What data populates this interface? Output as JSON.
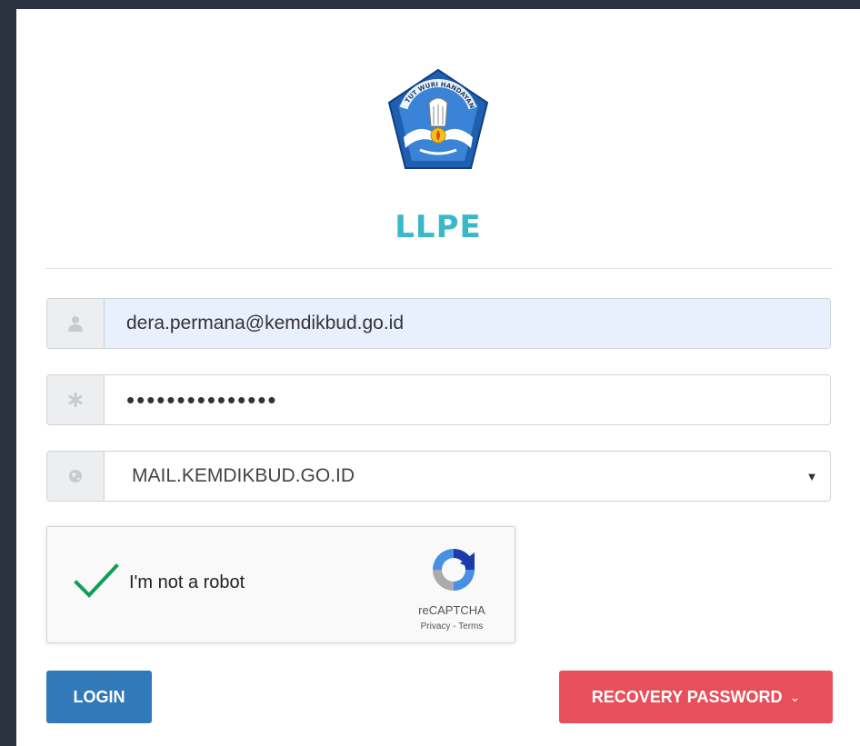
{
  "header": {
    "logo_alt": "Tut Wuri Handayani emblem",
    "logo_text": "TUT WURI HANDAYANI",
    "title": "LLPE"
  },
  "form": {
    "username": {
      "value": "dera.permana@kemdikbud.go.id",
      "icon": "user-icon"
    },
    "password": {
      "value": "•••••••••••••••",
      "icon": "asterisk-icon"
    },
    "server": {
      "selected": "MAIL.KEMDIKBUD.GO.ID",
      "icon": "globe-icon"
    }
  },
  "recaptcha": {
    "label": "I'm not a robot",
    "checked": true,
    "brand": "reCAPTCHA",
    "privacy": "Privacy",
    "separator": " - ",
    "terms": "Terms"
  },
  "buttons": {
    "login": "LOGIN",
    "recovery": "RECOVERY PASSWORD",
    "recovery_chevron": "⌄"
  },
  "colors": {
    "title": "#3bb8c8",
    "login_button": "#3179b8",
    "recovery_button": "#e7505a",
    "check": "#0f9d58",
    "autofill_bg": "#e8f0fe"
  }
}
